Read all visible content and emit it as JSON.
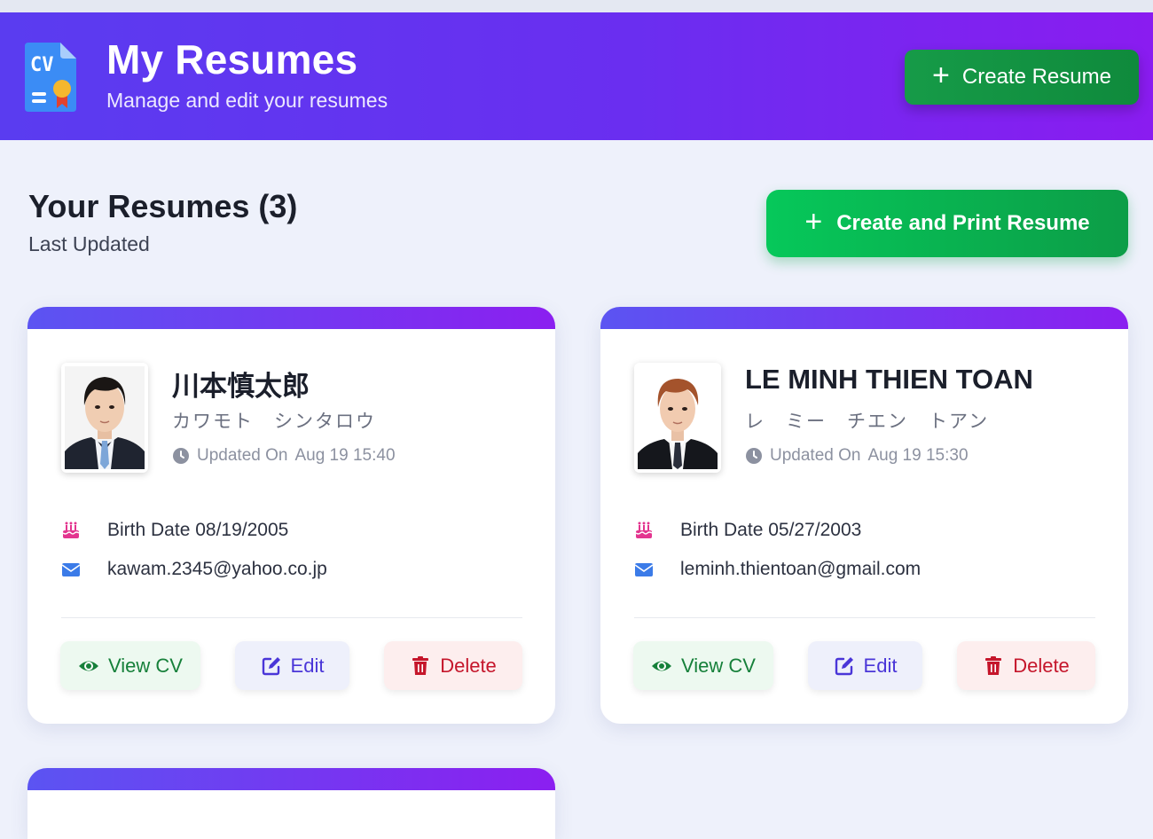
{
  "header": {
    "title": "My Resumes",
    "subtitle": "Manage and edit your resumes",
    "create_button": "Create Resume",
    "logo_text": "CV"
  },
  "section": {
    "title": "Your Resumes (3)",
    "subtitle": "Last Updated",
    "print_button": "Create and Print Resume"
  },
  "colors": {
    "header_start": "#5a3cf0",
    "header_end": "#8a1cf0",
    "create_green": "#169b48",
    "print_green": "#06c85a",
    "view_color": "#16803a",
    "edit_color": "#4a36d8",
    "delete_color": "#c5162b"
  },
  "resumes": [
    {
      "name": "川本慎太郎",
      "kana": "カワモト　シンタロウ",
      "updated_label": "Updated On",
      "updated_value": "Aug 19 15:40",
      "birth": "Birth Date 08/19/2005",
      "email": "kawam.2345@yahoo.co.jp",
      "view_label": "View CV",
      "edit_label": "Edit",
      "delete_label": "Delete"
    },
    {
      "name": "LE MINH THIEN TOAN",
      "kana": "レ　ミー　チエン　トアン",
      "updated_label": "Updated On",
      "updated_value": "Aug 19 15:30",
      "birth": "Birth Date 05/27/2003",
      "email": "leminh.thientoan@gmail.com",
      "view_label": "View CV",
      "edit_label": "Edit",
      "delete_label": "Delete"
    }
  ],
  "icons": {
    "logo": "cv-document-icon",
    "plus": "plus-icon",
    "clock": "clock-icon",
    "birthday": "birthday-cake-icon",
    "email": "envelope-icon",
    "view": "eye-icon",
    "edit": "edit-icon",
    "delete": "trash-icon"
  }
}
